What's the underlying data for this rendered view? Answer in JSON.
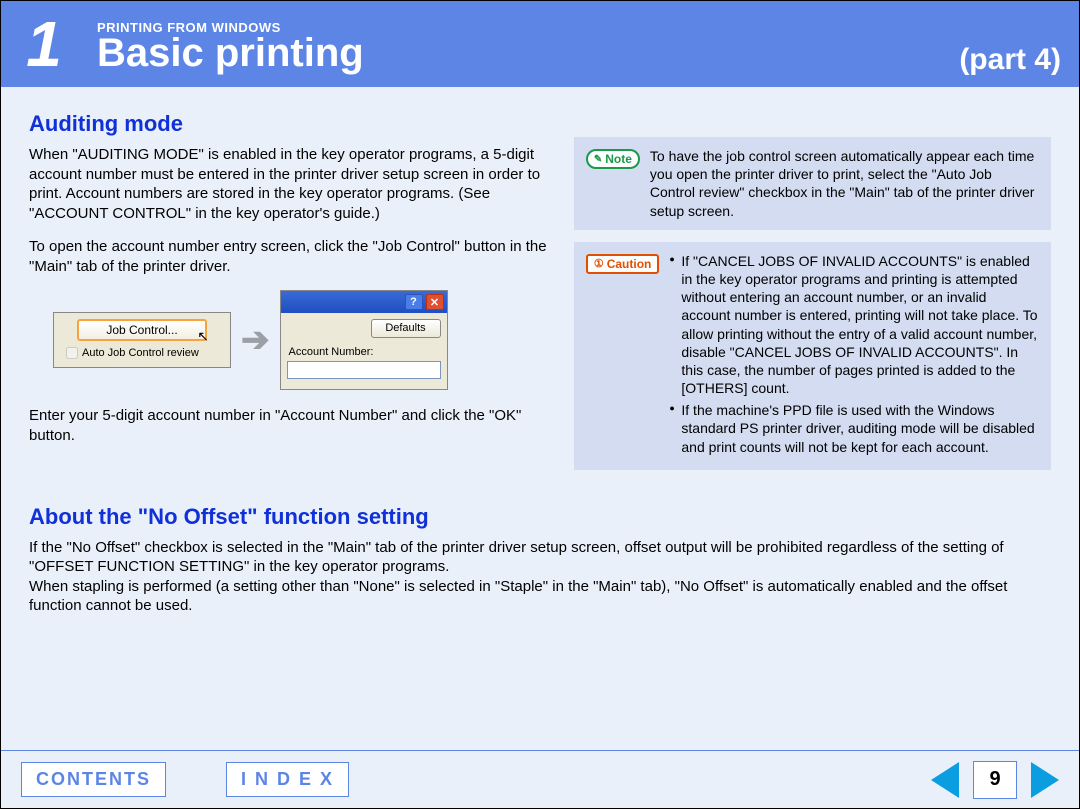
{
  "header": {
    "chapter_number": "1",
    "pretitle": "PRINTING FROM WINDOWS",
    "title": "Basic printing",
    "part": "(part 4)"
  },
  "section1": {
    "heading": "Auditing mode",
    "p1": "When \"AUDITING MODE\" is enabled in the key operator programs, a 5-digit account number must be entered in the printer driver setup screen in order to print. Account numbers are stored in the key operator programs. (See \"ACCOUNT CONTROL\" in the key operator's guide.)",
    "p2": "To open the account number entry screen, click the \"Job Control\" button in the \"Main\" tab of the printer driver.",
    "p3": "Enter your 5-digit account number in \"Account Number\" and click the \"OK\" button."
  },
  "screenshot1": {
    "button": "Job Control...",
    "checkbox_label": "Auto Job Control review"
  },
  "screenshot2": {
    "defaults_btn": "Defaults",
    "field_label": "Account Number:"
  },
  "note": {
    "label": "Note",
    "text": "To have the job control screen automatically appear each time you open the printer driver to print, select the \"Auto Job Control review\" checkbox in the \"Main\" tab of the printer driver setup screen."
  },
  "caution": {
    "label": "Caution",
    "bullet1": "If \"CANCEL JOBS OF INVALID ACCOUNTS\" is enabled in the key operator programs and printing is attempted without entering an account number, or an invalid account number is entered, printing will not take place. To allow printing without the entry of a valid account number, disable \"CANCEL JOBS OF INVALID ACCOUNTS\". In this case, the number of pages printed is added to the [OTHERS] count.",
    "bullet2": "If the machine's PPD file is used with the Windows standard PS printer driver, auditing mode will be disabled and print counts will not be kept for each account."
  },
  "section2": {
    "heading": "About the \"No Offset\" function setting",
    "p1": "If the \"No Offset\" checkbox is selected in the \"Main\" tab of the printer driver setup screen, offset output will be prohibited regardless of the setting of \"OFFSET FUNCTION SETTING\" in the key operator programs.",
    "p2": "When stapling is performed (a setting other than \"None\" is selected in \"Staple\" in the \"Main\" tab), \"No Offset\" is automatically enabled and the offset function cannot be used."
  },
  "footer": {
    "contents": "CONTENTS",
    "index": "I N D E X",
    "page": "9"
  }
}
